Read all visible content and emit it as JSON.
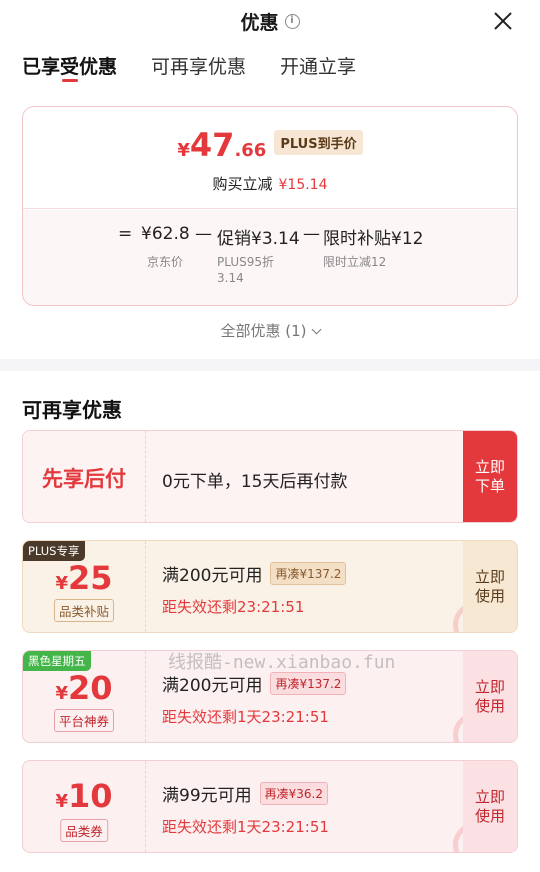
{
  "header": {
    "title": "优惠",
    "info_glyph": "i"
  },
  "tabs": [
    {
      "label": "已享受优惠",
      "active": true
    },
    {
      "label": "可再享优惠",
      "active": false
    },
    {
      "label": "开通立享",
      "active": false
    }
  ],
  "price_card": {
    "currency": "¥",
    "price_int": "47",
    "price_dec": ".66",
    "badge": "PLUS到手价",
    "reduce_label": "购买立减",
    "reduce_amount": "¥15.14",
    "formula": {
      "eq": "=",
      "jd_price": "¥62.8",
      "minus1": "—",
      "promo": "促销¥3.14",
      "minus2": "—",
      "subsidy": "限时补贴¥12",
      "jd_price_label": "京东价",
      "promo_label": "PLUS95折\n3.14",
      "subsidy_label": "限时立减12"
    },
    "all_discounts": "全部优惠 (1)"
  },
  "section": {
    "title": "可再享优惠"
  },
  "paylater": {
    "title": "先享后付",
    "desc": "0元下单，15天后再付款",
    "action": "立即下单"
  },
  "coupons": [
    {
      "tag": "PLUS专享",
      "currency": "¥",
      "amount": "25",
      "label": "品类补贴",
      "condition": "满200元可用",
      "extra": "再凑¥137.2",
      "expire": "距失效还剩23:21:51",
      "action": "立即使用"
    },
    {
      "tag": "黑色星期五",
      "currency": "¥",
      "amount": "20",
      "label": "平台神券",
      "condition": "满200元可用",
      "extra": "再凑¥137.2",
      "expire": "距失效还剩1天23:21:51",
      "action": "立即使用"
    },
    {
      "tag": "",
      "currency": "¥",
      "amount": "10",
      "label": "品类券",
      "condition": "满99元可用",
      "extra": "再凑¥36.2",
      "expire": "距失效还剩1天23:21:51",
      "action": "立即使用"
    }
  ],
  "watermark": "线报酷-new.xianbao.fun",
  "colors": {
    "accent": "#e4393c",
    "plus_brown": "#5b3a1a",
    "green_tag": "#43b549"
  }
}
